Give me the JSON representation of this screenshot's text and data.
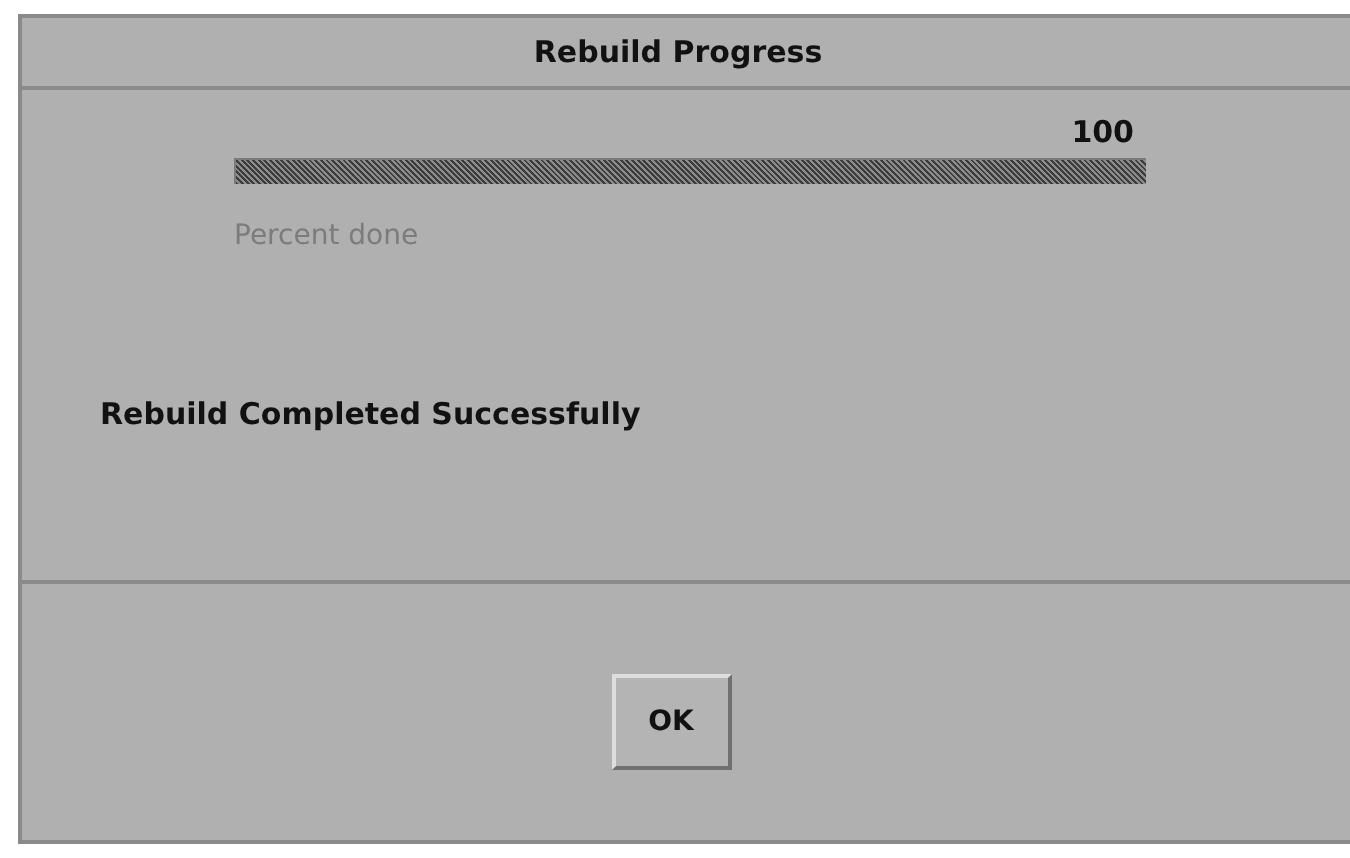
{
  "window": {
    "title": "Rebuild Progress"
  },
  "progress": {
    "reading": "100",
    "level": 1.0,
    "caption": {
      "text": "Percent done",
      "disabled": true
    }
  },
  "message": "Rebuild Completed Successfully",
  "buttons": [
    {
      "label": "OK"
    }
  ]
}
